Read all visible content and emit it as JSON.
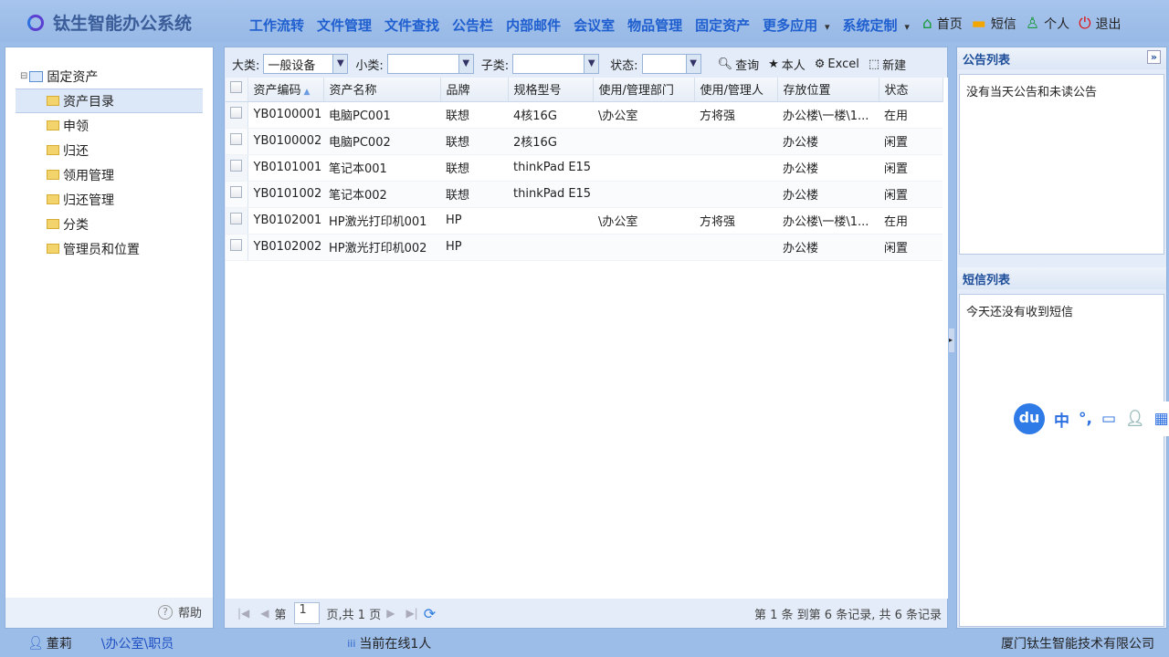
{
  "app": {
    "title": "钛生智能办公系统"
  },
  "nav": [
    "工作流转",
    "文件管理",
    "文件查找",
    "公告栏",
    "内部邮件",
    "会议室",
    "物品管理",
    "固定资产",
    "更多应用",
    "系统定制"
  ],
  "top_links": [
    {
      "icon": "home-icon",
      "label": "首页"
    },
    {
      "icon": "message-icon",
      "label": "短信"
    },
    {
      "icon": "user-icon",
      "label": "个人"
    },
    {
      "icon": "power-icon",
      "label": "退出"
    }
  ],
  "tree": {
    "root": "固定资产",
    "items": [
      "资产目录",
      "申领",
      "归还",
      "领用管理",
      "归还管理",
      "分类",
      "管理员和位置"
    ],
    "selected": "资产目录"
  },
  "help": "帮助",
  "toolbar": {
    "category_label": "大类:",
    "category_value": "一般设备",
    "subcategory_label": "小类:",
    "subcategory_value": "",
    "child_label": "子类:",
    "child_value": "",
    "status_label": "状态:",
    "status_value": "",
    "query": "查询",
    "mine": "本人",
    "excel": "Excel",
    "new": "新建"
  },
  "columns": [
    "资产编码",
    "资产名称",
    "品牌",
    "规格型号",
    "使用/管理部门",
    "使用/管理人",
    "存放位置",
    "状态"
  ],
  "rows": [
    [
      "YB0100001",
      "电脑PC001",
      "联想",
      "4核16G",
      "\\办公室",
      "方将强",
      "办公楼\\一楼\\1...",
      "在用"
    ],
    [
      "YB0100002",
      "电脑PC002",
      "联想",
      "2核16G",
      "",
      "",
      "办公楼",
      "闲置"
    ],
    [
      "YB0101001",
      "笔记本001",
      "联想",
      "thinkPad E15",
      "",
      "",
      "办公楼",
      "闲置"
    ],
    [
      "YB0101002",
      "笔记本002",
      "联想",
      "thinkPad E15",
      "",
      "",
      "办公楼",
      "闲置"
    ],
    [
      "YB0102001",
      "HP激光打印机001",
      "HP",
      "",
      "\\办公室",
      "方将强",
      "办公楼\\一楼\\1...",
      "在用"
    ],
    [
      "YB0102002",
      "HP激光打印机002",
      "HP",
      "",
      "",
      "",
      "办公楼",
      "闲置"
    ]
  ],
  "pager": {
    "prefix": "第",
    "page": "1",
    "suffix": "页,共 1 页",
    "summary": "第 1 条 到第 6 条记录,  共 6 条记录"
  },
  "notices": {
    "title": "公告列表",
    "content": "没有当天公告和未读公告"
  },
  "sms": {
    "title": "短信列表",
    "content": "今天还没有收到短信"
  },
  "status": {
    "user": "董莉",
    "dept": "\\办公室\\职员",
    "online": "当前在线1人",
    "company": "厦门钛生智能技术有限公司"
  },
  "ime": {
    "logo": "du",
    "items": [
      "中",
      "°,"
    ]
  }
}
